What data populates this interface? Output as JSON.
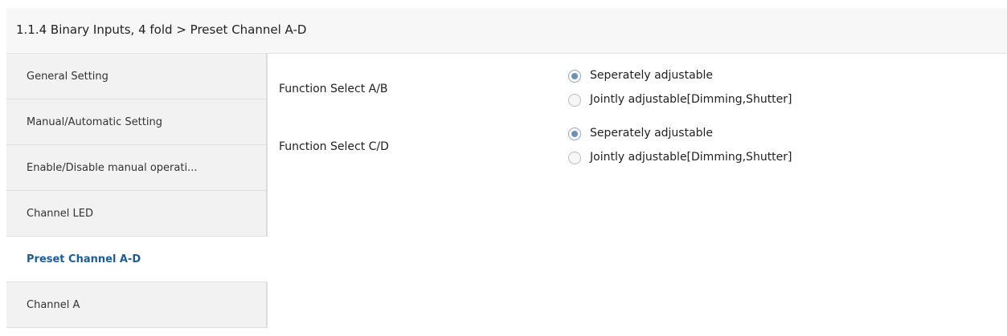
{
  "header": {
    "title": "1.1.4 Binary Inputs, 4 fold > Preset Channel A-D"
  },
  "sidebar": {
    "items": [
      {
        "label": "General Setting",
        "active": false
      },
      {
        "label": "Manual/Automatic Setting",
        "active": false
      },
      {
        "label": "Enable/Disable manual operati...",
        "active": false
      },
      {
        "label": "Channel LED",
        "active": false
      },
      {
        "label": "Preset Channel A-D",
        "active": true
      },
      {
        "label": "Channel A",
        "active": false
      }
    ]
  },
  "params": [
    {
      "label": "Function Select A/B",
      "options": [
        {
          "label": "Seperately adjustable",
          "checked": true
        },
        {
          "label": "Jointly adjustable[Dimming,Shutter]",
          "checked": false
        }
      ]
    },
    {
      "label": "Function Select C/D",
      "options": [
        {
          "label": "Seperately adjustable",
          "checked": true
        },
        {
          "label": "Jointly adjustable[Dimming,Shutter]",
          "checked": false
        }
      ]
    }
  ],
  "colors": {
    "active_item_text": "#1e5c97",
    "radio_dot": "#6e8fb8"
  }
}
